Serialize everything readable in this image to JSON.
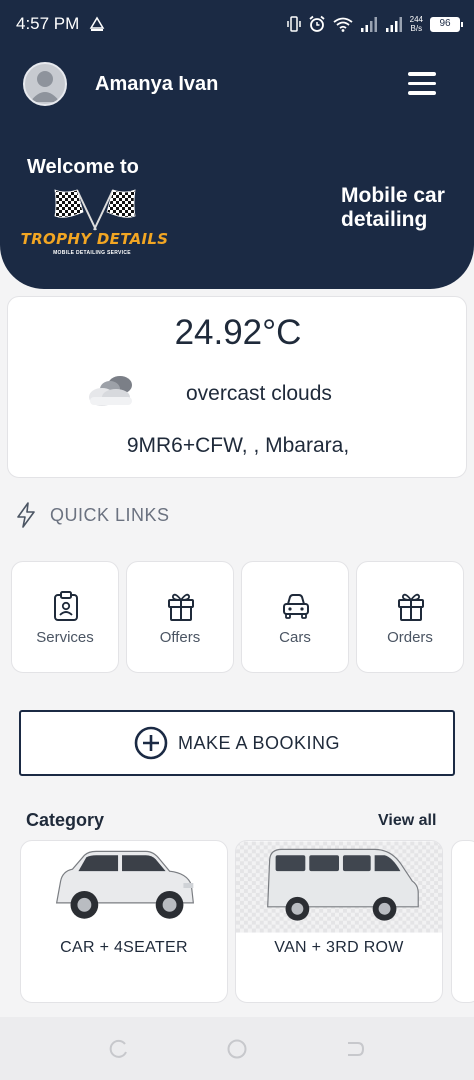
{
  "status_bar": {
    "time": "4:57 PM",
    "network_speed_value": "244",
    "network_speed_unit": "B/s",
    "battery": "96"
  },
  "header": {
    "user_name": "Amanya Ivan",
    "welcome": "Welcome to",
    "logo_text": "TROPHY DETAILS",
    "logo_subtitle": "MOBILE DETAILING SERVICE",
    "tagline": "Mobile car detailing"
  },
  "weather": {
    "temperature": "24.92°C",
    "description": "overcast clouds",
    "location": "9MR6+CFW, , Mbarara,"
  },
  "quick_links": {
    "title": "QUICK LINKS",
    "items": [
      {
        "label": "Services",
        "icon": "clipboard-icon"
      },
      {
        "label": "Offers",
        "icon": "gift-icon"
      },
      {
        "label": "Cars",
        "icon": "car-icon"
      },
      {
        "label": "Orders",
        "icon": "gift-icon"
      }
    ]
  },
  "booking": {
    "label": "MAKE A BOOKING"
  },
  "category": {
    "title": "Category",
    "view_all": "View all",
    "items": [
      {
        "label": "CAR + 4SEATER"
      },
      {
        "label": "VAN + 3RD ROW"
      }
    ]
  },
  "colors": {
    "primary": "#1b2a44",
    "logo_accent": "#f2a623",
    "background": "#f4f4f5"
  }
}
